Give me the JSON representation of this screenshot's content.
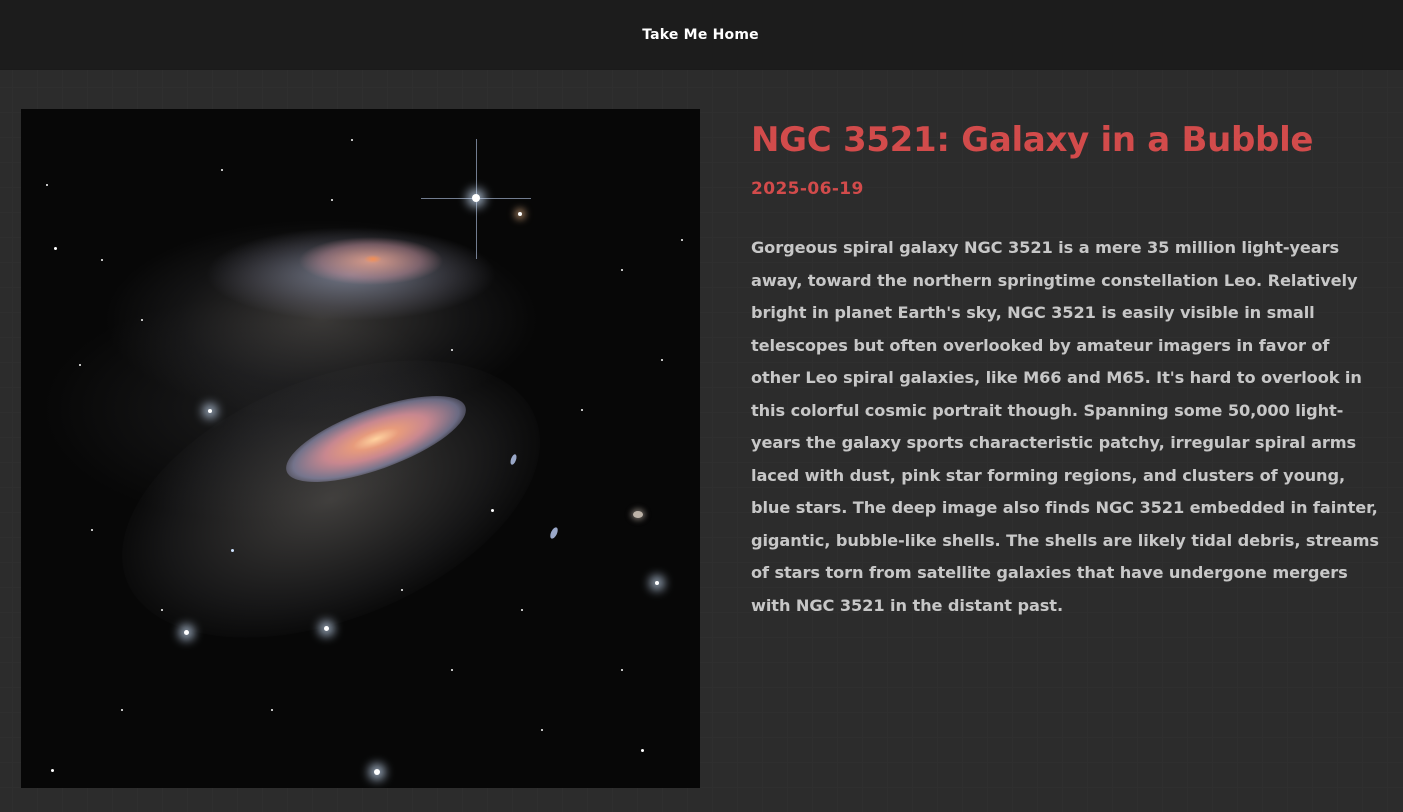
{
  "nav": {
    "home_label": "Take Me Home"
  },
  "apod": {
    "title": "NGC 3521: Galaxy in a Bubble",
    "date": "2025-06-19",
    "explanation": "Gorgeous spiral galaxy NGC 3521 is a mere 35 million light-years away, toward the northern springtime constellation Leo. Relatively bright in planet Earth's sky, NGC 3521 is easily visible in small telescopes but often overlooked by amateur imagers in favor of other Leo spiral galaxies, like M66 and M65. It's hard to overlook in this colorful cosmic portrait though. Spanning some 50,000 light-years the galaxy sports characteristic patchy, irregular spiral arms laced with dust, pink star forming regions, and clusters of young, blue stars. The deep image also finds NGC 3521 embedded in fainter, gigantic, bubble-like shells. The shells are likely tidal debris, streams of stars torn from satellite galaxies that have undergone mergers with NGC 3521 in the distant past."
  },
  "colors": {
    "accent": "#d24b4b",
    "background": "#222222",
    "topbar": "#1c1c1c",
    "body_text": "#c7c7c7"
  }
}
